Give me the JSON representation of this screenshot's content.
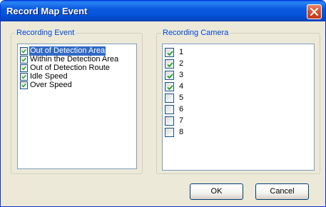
{
  "dialog": {
    "title": "Record Map Event",
    "close_icon": "close-icon",
    "accent_color": "#0a5fe6",
    "close_color": "#d5512d"
  },
  "recording_event": {
    "label": "Recording Event",
    "items": [
      {
        "label": "Out of Detection Area",
        "checked": true,
        "selected": true
      },
      {
        "label": "Within the Detection Area",
        "checked": true,
        "selected": false
      },
      {
        "label": "Out of Detection Route",
        "checked": true,
        "selected": false
      },
      {
        "label": "Idle Speed",
        "checked": true,
        "selected": false
      },
      {
        "label": "Over Speed",
        "checked": true,
        "selected": false
      }
    ]
  },
  "recording_camera": {
    "label": "Recording Camera",
    "items": [
      {
        "label": "1",
        "checked": true
      },
      {
        "label": "2",
        "checked": true
      },
      {
        "label": "3",
        "checked": true
      },
      {
        "label": "4",
        "checked": true
      },
      {
        "label": "5",
        "checked": false
      },
      {
        "label": "6",
        "checked": false
      },
      {
        "label": "7",
        "checked": false
      },
      {
        "label": "8",
        "checked": false
      }
    ]
  },
  "buttons": {
    "ok_label": "OK",
    "cancel_label": "Cancel"
  }
}
